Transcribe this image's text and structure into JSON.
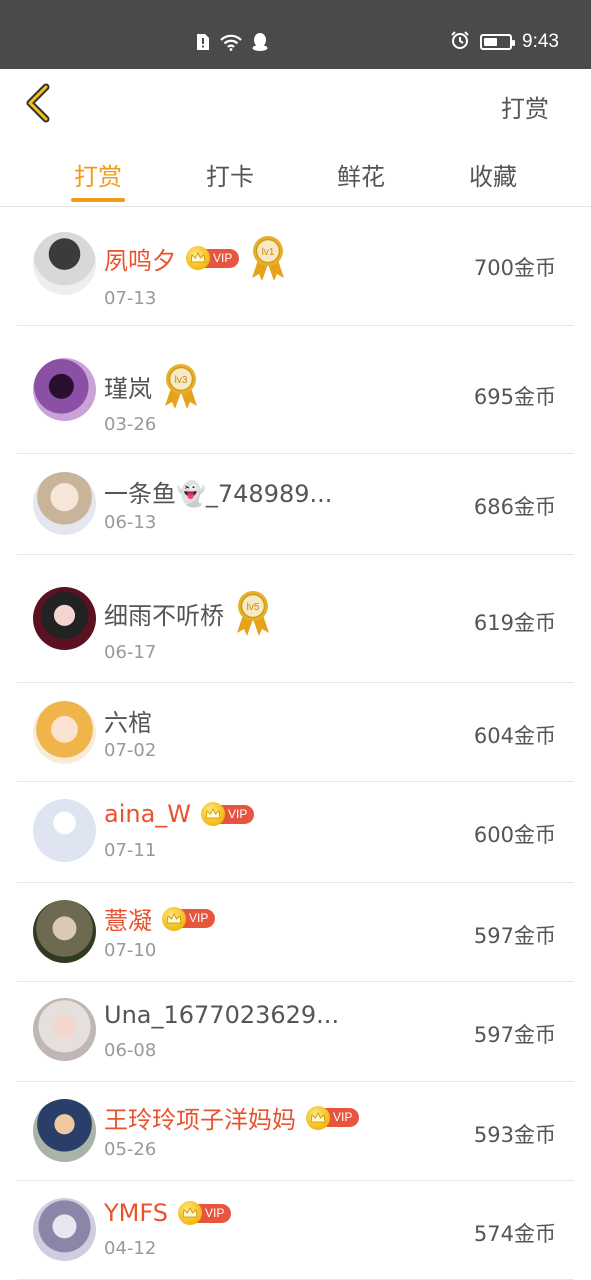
{
  "status_bar": {
    "time": "9:43",
    "battery_level": 0.55
  },
  "header": {
    "action_label": "打赏"
  },
  "tabs": [
    {
      "label": "打赏",
      "active": true
    },
    {
      "label": "打卡",
      "active": false
    },
    {
      "label": "鲜花",
      "active": false
    },
    {
      "label": "收藏",
      "active": false
    }
  ],
  "colors": {
    "accent": "#f39a18",
    "vip_name": "#e8532e",
    "vip_tag": "#e8553e",
    "medal_gold": "#e6b12a"
  },
  "rows": [
    {
      "name": "夙鸣夕",
      "date": "07-13",
      "coins": "700金币",
      "vip": true,
      "vip_tag": "VIP",
      "medal": "lv1"
    },
    {
      "name": "瑾岚",
      "date": "03-26",
      "coins": "695金币",
      "vip": false,
      "medal": "lv3"
    },
    {
      "name": "一条鱼👻_748989...",
      "date": "06-13",
      "coins": "686金币",
      "vip": false
    },
    {
      "name": "细雨不听桥",
      "date": "06-17",
      "coins": "619金币",
      "vip": false,
      "medal": "lv5"
    },
    {
      "name": "六棺",
      "date": "07-02",
      "coins": "604金币",
      "vip": false
    },
    {
      "name": "aina_W",
      "date": "07-11",
      "coins": "600金币",
      "vip": true,
      "vip_tag": "VIP"
    },
    {
      "name": "薏凝",
      "date": "07-10",
      "coins": "597金币",
      "vip": true,
      "vip_tag": "VIP"
    },
    {
      "name": "Una_1677023629...",
      "date": "06-08",
      "coins": "597金币",
      "vip": false
    },
    {
      "name": "王玲玲项子洋妈妈",
      "date": "05-26",
      "coins": "593金币",
      "vip": true,
      "vip_tag": "VIP"
    },
    {
      "name": "YMFS",
      "date": "04-12",
      "coins": "574金币",
      "vip": true,
      "vip_tag": "VIP"
    }
  ]
}
